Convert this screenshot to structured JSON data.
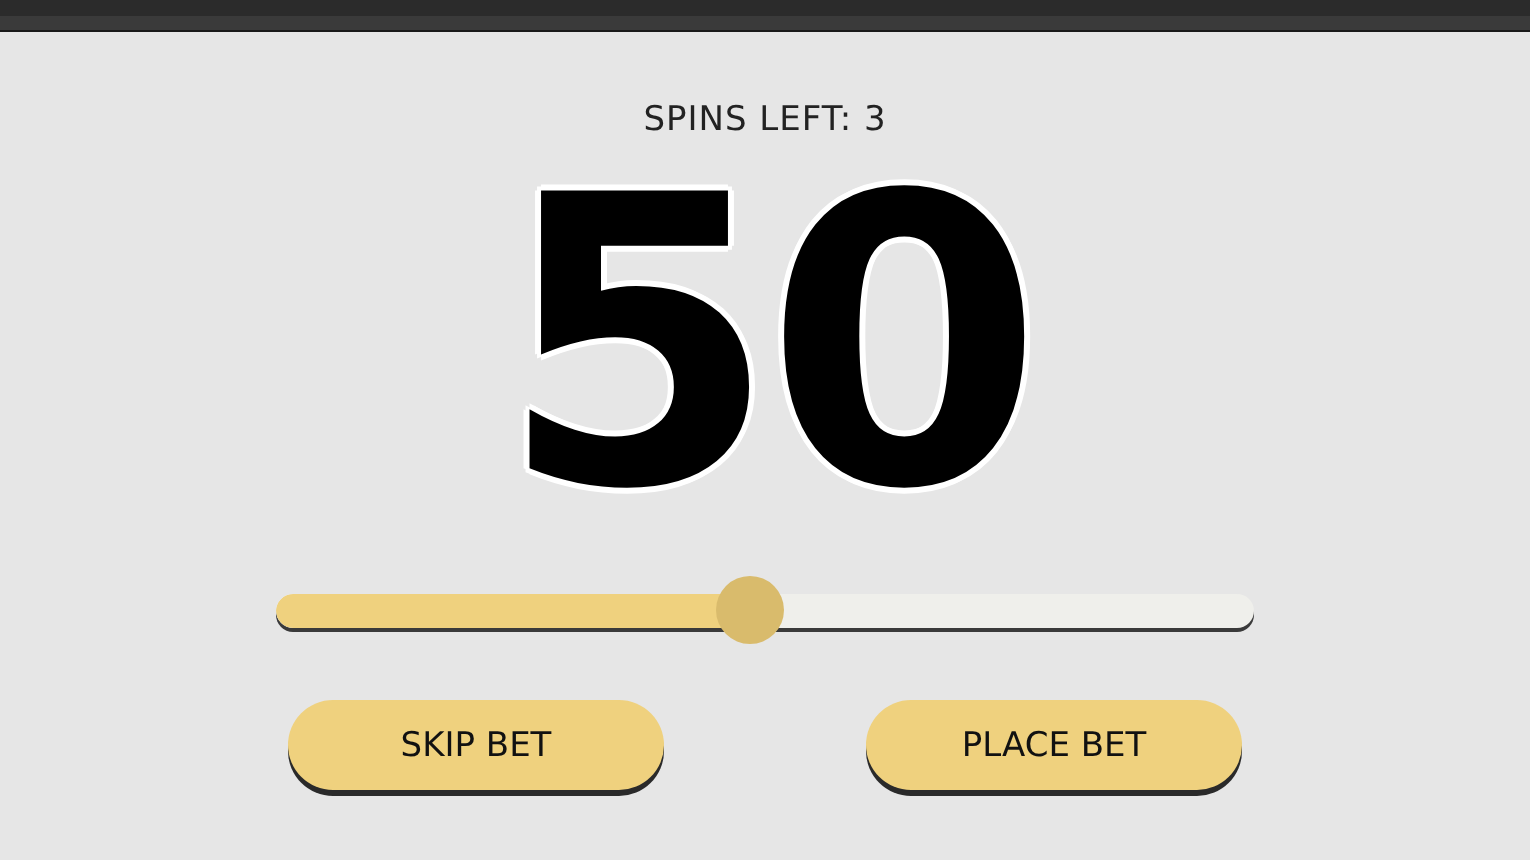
{
  "spins_label": "SPINS LEFT: 3",
  "value": "50",
  "slider": {
    "level": 0.485
  },
  "buttons": [
    {
      "label": "SKIP BET"
    },
    {
      "label": "PLACE BET"
    }
  ]
}
